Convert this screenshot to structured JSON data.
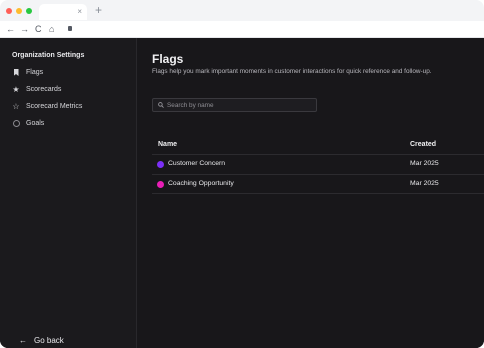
{
  "browser": {
    "tab_close": "×",
    "new_tab": "+",
    "nav": {
      "back": "←",
      "forward": "→",
      "reload": "C",
      "home": "⌂"
    }
  },
  "sidebar": {
    "heading": "Organization Settings",
    "items": [
      {
        "icon": "bookmark-icon",
        "label": "Flags"
      },
      {
        "icon": "star-icon",
        "glyph": "★",
        "label": "Scorecards"
      },
      {
        "icon": "star-outline-icon",
        "glyph": "☆",
        "label": "Scorecard Metrics"
      },
      {
        "icon": "target-icon",
        "label": "Goals"
      }
    ],
    "go_back": {
      "arrow": "←",
      "label": "Go back"
    }
  },
  "main": {
    "title": "Flags",
    "subtitle": "Flags help you mark important moments in customer interactions for quick reference and follow-up.",
    "search": {
      "placeholder": "Search by name",
      "value": ""
    },
    "table": {
      "headers": {
        "name": "Name",
        "created": "Created"
      },
      "rows": [
        {
          "name": "Customer Concern",
          "created": "Mar 2025",
          "color": "#7b2ff7"
        },
        {
          "name": "Coaching Opportunity",
          "created": "Mar 2025",
          "color": "#e91eb6"
        }
      ]
    }
  }
}
